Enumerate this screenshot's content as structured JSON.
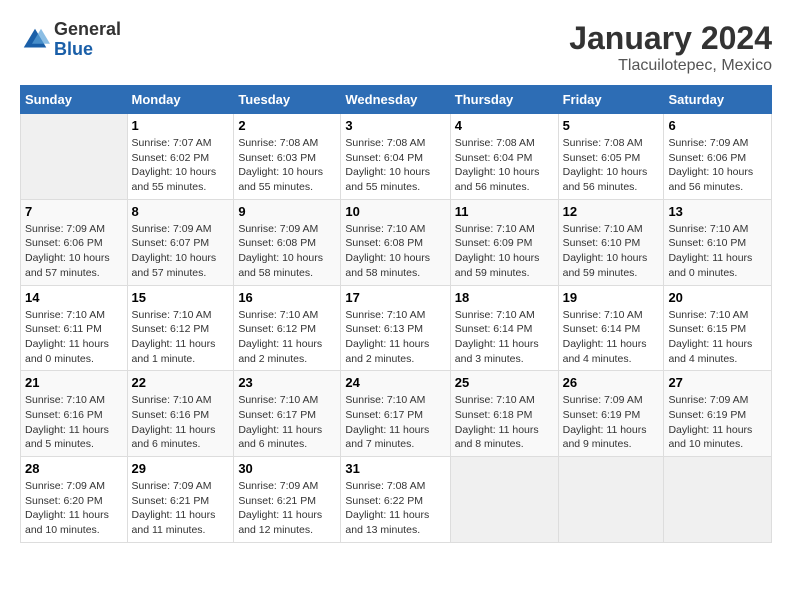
{
  "logo": {
    "general": "General",
    "blue": "Blue"
  },
  "title": "January 2024",
  "subtitle": "Tlacuilotepec, Mexico",
  "days_header": [
    "Sunday",
    "Monday",
    "Tuesday",
    "Wednesday",
    "Thursday",
    "Friday",
    "Saturday"
  ],
  "weeks": [
    [
      {
        "day": "",
        "info": ""
      },
      {
        "day": "1",
        "info": "Sunrise: 7:07 AM\nSunset: 6:02 PM\nDaylight: 10 hours\nand 55 minutes."
      },
      {
        "day": "2",
        "info": "Sunrise: 7:08 AM\nSunset: 6:03 PM\nDaylight: 10 hours\nand 55 minutes."
      },
      {
        "day": "3",
        "info": "Sunrise: 7:08 AM\nSunset: 6:04 PM\nDaylight: 10 hours\nand 55 minutes."
      },
      {
        "day": "4",
        "info": "Sunrise: 7:08 AM\nSunset: 6:04 PM\nDaylight: 10 hours\nand 56 minutes."
      },
      {
        "day": "5",
        "info": "Sunrise: 7:08 AM\nSunset: 6:05 PM\nDaylight: 10 hours\nand 56 minutes."
      },
      {
        "day": "6",
        "info": "Sunrise: 7:09 AM\nSunset: 6:06 PM\nDaylight: 10 hours\nand 56 minutes."
      }
    ],
    [
      {
        "day": "7",
        "info": "Sunrise: 7:09 AM\nSunset: 6:06 PM\nDaylight: 10 hours\nand 57 minutes."
      },
      {
        "day": "8",
        "info": "Sunrise: 7:09 AM\nSunset: 6:07 PM\nDaylight: 10 hours\nand 57 minutes."
      },
      {
        "day": "9",
        "info": "Sunrise: 7:09 AM\nSunset: 6:08 PM\nDaylight: 10 hours\nand 58 minutes."
      },
      {
        "day": "10",
        "info": "Sunrise: 7:10 AM\nSunset: 6:08 PM\nDaylight: 10 hours\nand 58 minutes."
      },
      {
        "day": "11",
        "info": "Sunrise: 7:10 AM\nSunset: 6:09 PM\nDaylight: 10 hours\nand 59 minutes."
      },
      {
        "day": "12",
        "info": "Sunrise: 7:10 AM\nSunset: 6:10 PM\nDaylight: 10 hours\nand 59 minutes."
      },
      {
        "day": "13",
        "info": "Sunrise: 7:10 AM\nSunset: 6:10 PM\nDaylight: 11 hours\nand 0 minutes."
      }
    ],
    [
      {
        "day": "14",
        "info": "Sunrise: 7:10 AM\nSunset: 6:11 PM\nDaylight: 11 hours\nand 0 minutes."
      },
      {
        "day": "15",
        "info": "Sunrise: 7:10 AM\nSunset: 6:12 PM\nDaylight: 11 hours\nand 1 minute."
      },
      {
        "day": "16",
        "info": "Sunrise: 7:10 AM\nSunset: 6:12 PM\nDaylight: 11 hours\nand 2 minutes."
      },
      {
        "day": "17",
        "info": "Sunrise: 7:10 AM\nSunset: 6:13 PM\nDaylight: 11 hours\nand 2 minutes."
      },
      {
        "day": "18",
        "info": "Sunrise: 7:10 AM\nSunset: 6:14 PM\nDaylight: 11 hours\nand 3 minutes."
      },
      {
        "day": "19",
        "info": "Sunrise: 7:10 AM\nSunset: 6:14 PM\nDaylight: 11 hours\nand 4 minutes."
      },
      {
        "day": "20",
        "info": "Sunrise: 7:10 AM\nSunset: 6:15 PM\nDaylight: 11 hours\nand 4 minutes."
      }
    ],
    [
      {
        "day": "21",
        "info": "Sunrise: 7:10 AM\nSunset: 6:16 PM\nDaylight: 11 hours\nand 5 minutes."
      },
      {
        "day": "22",
        "info": "Sunrise: 7:10 AM\nSunset: 6:16 PM\nDaylight: 11 hours\nand 6 minutes."
      },
      {
        "day": "23",
        "info": "Sunrise: 7:10 AM\nSunset: 6:17 PM\nDaylight: 11 hours\nand 6 minutes."
      },
      {
        "day": "24",
        "info": "Sunrise: 7:10 AM\nSunset: 6:17 PM\nDaylight: 11 hours\nand 7 minutes."
      },
      {
        "day": "25",
        "info": "Sunrise: 7:10 AM\nSunset: 6:18 PM\nDaylight: 11 hours\nand 8 minutes."
      },
      {
        "day": "26",
        "info": "Sunrise: 7:09 AM\nSunset: 6:19 PM\nDaylight: 11 hours\nand 9 minutes."
      },
      {
        "day": "27",
        "info": "Sunrise: 7:09 AM\nSunset: 6:19 PM\nDaylight: 11 hours\nand 10 minutes."
      }
    ],
    [
      {
        "day": "28",
        "info": "Sunrise: 7:09 AM\nSunset: 6:20 PM\nDaylight: 11 hours\nand 10 minutes."
      },
      {
        "day": "29",
        "info": "Sunrise: 7:09 AM\nSunset: 6:21 PM\nDaylight: 11 hours\nand 11 minutes."
      },
      {
        "day": "30",
        "info": "Sunrise: 7:09 AM\nSunset: 6:21 PM\nDaylight: 11 hours\nand 12 minutes."
      },
      {
        "day": "31",
        "info": "Sunrise: 7:08 AM\nSunset: 6:22 PM\nDaylight: 11 hours\nand 13 minutes."
      },
      {
        "day": "",
        "info": ""
      },
      {
        "day": "",
        "info": ""
      },
      {
        "day": "",
        "info": ""
      }
    ]
  ]
}
